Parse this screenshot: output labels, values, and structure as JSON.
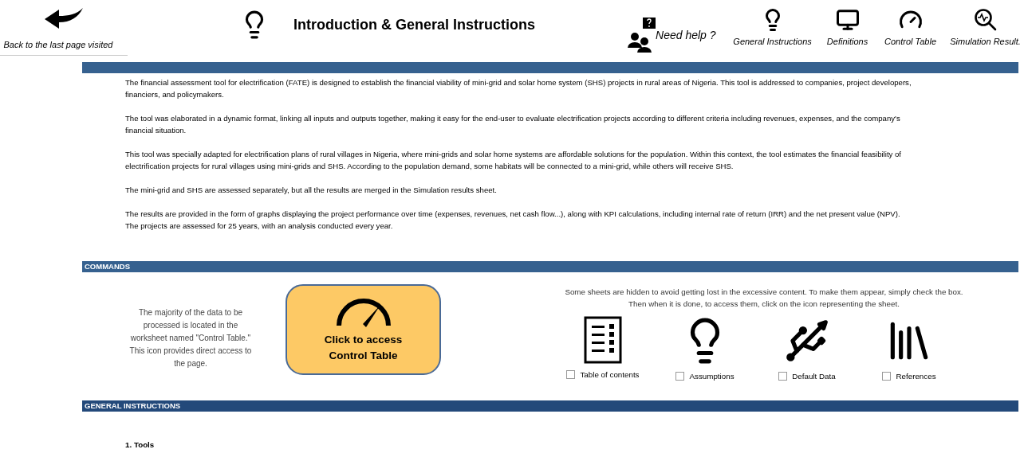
{
  "header": {
    "back_label": "Back to the last page visited",
    "title": "Introduction & General Instructions",
    "help_label": "Need help ?",
    "nav": [
      {
        "kind": "instructions",
        "label": "General Instructions"
      },
      {
        "kind": "definitions",
        "label": "Definitions"
      },
      {
        "kind": "control",
        "label": "Control Table"
      },
      {
        "kind": "simulation",
        "label": "Simulation Result."
      }
    ]
  },
  "intro": {
    "paragraphs": [
      "The financial assessment tool for electrification (FATE) is designed to establish the financial viability of mini-grid and solar home system (SHS) projects in rural areas of Nigeria. This tool is addressed to companies, project developers, financiers, and policymakers.",
      "The tool was elaborated in a dynamic format, linking all inputs and outputs together, making it easy for the end-user to evaluate electrification projects according to different criteria including revenues, expenses, and the company's financial situation.",
      "This tool was specially adapted for electrification plans of rural villages in Nigeria, where mini-grids and solar home systems are affordable solutions for the population. Within this context, the tool estimates the financial feasibility of electrification projects for rural villages using mini-grids and SHS. According to the population demand, some habitats will be connected to a mini-grid, while others will receive SHS.",
      "The mini-grid and SHS are assessed separately, but all the results are merged in the Simulation results sheet.",
      "The results are provided in the form of graphs displaying the project performance over time (expenses, revenues, net cash flow...), along with KPI calculations, including internal rate of return (IRR) and the net present value (NPV). The projects are assessed for 25 years, with an analysis conducted every year."
    ]
  },
  "commands": {
    "title": "COMMANDS",
    "note": "The majority of the data to be processed is located in the worksheet named \"Control Table.\" This icon provides direct access to the page.",
    "button": "Click to access Control Table",
    "hidden_note": [
      "Some sheets are hidden to avoid getting lost in the excessive content. To make them appear, simply check the box.",
      "Then when it is done, to access them, click on the icon representing the sheet."
    ],
    "sheets": [
      {
        "kind": "contents",
        "label": "Table of contents",
        "checked": false
      },
      {
        "kind": "assumptions",
        "label": "Assumptions",
        "checked": false
      },
      {
        "kind": "data",
        "label": "Default Data",
        "checked": false
      },
      {
        "kind": "references",
        "label": "References",
        "checked": false
      }
    ]
  },
  "general": {
    "title": "GENERAL INSTRUCTIONS",
    "subtitle": "1. Tools"
  }
}
